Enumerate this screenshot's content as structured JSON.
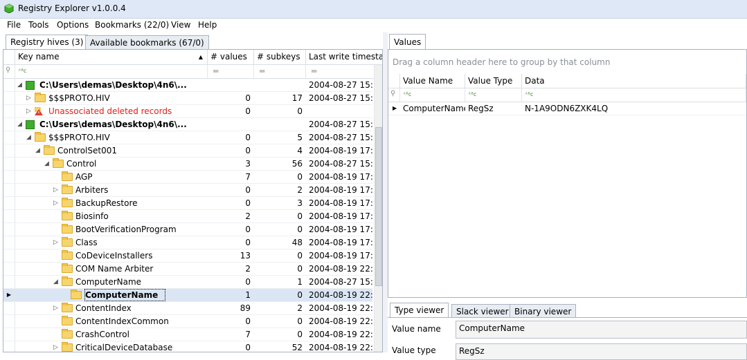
{
  "window": {
    "title": "Registry Explorer v1.0.0.4"
  },
  "menu": [
    "File",
    "Tools",
    "Options",
    "Bookmarks (22/0)",
    "View",
    "Help"
  ],
  "left_tabs": [
    {
      "label": "Registry hives (3)",
      "active": true
    },
    {
      "label": "Available bookmarks (67/0)",
      "active": false
    }
  ],
  "tree_columns": [
    "Key name",
    "# values",
    "# subkeys",
    "Last write timestamp"
  ],
  "filter_symbols": {
    "abc": "ᴬᴮc",
    "eq": "═",
    "pin": "⚲"
  },
  "tree_rows": [
    {
      "name": "C:\\Users\\demas\\Desktop\\4n6\\...",
      "type": "hive",
      "expanded": true,
      "values": "",
      "subkeys": "",
      "ts": "2004-08-27 15:4",
      "bold": true
    },
    {
      "name": "$$$PROTO.HIV",
      "type": "folder",
      "expandable": true,
      "values": "0",
      "subkeys": "17",
      "ts": "2004-08-27 15:1"
    },
    {
      "name": "Unassociated deleted records",
      "type": "warn",
      "expandable": true,
      "values": "0",
      "subkeys": "0",
      "ts": "",
      "red": true
    },
    {
      "name": "C:\\Users\\demas\\Desktop\\4n6\\...",
      "type": "hive",
      "expanded": true,
      "values": "",
      "subkeys": "",
      "ts": "2004-08-27 15:4",
      "bold": true
    },
    {
      "name": "$$$PROTO.HIV",
      "type": "folder",
      "expanded": true,
      "values": "0",
      "subkeys": "5",
      "ts": "2004-08-27 15:0"
    },
    {
      "name": "ControlSet001",
      "type": "folder",
      "expanded": true,
      "values": "0",
      "subkeys": "4",
      "ts": "2004-08-19 17:0"
    },
    {
      "name": "Control",
      "type": "folder",
      "expanded": true,
      "values": "3",
      "subkeys": "56",
      "ts": "2004-08-27 15:0"
    },
    {
      "name": "AGP",
      "type": "folder",
      "values": "7",
      "subkeys": "0",
      "ts": "2004-08-19 17:0"
    },
    {
      "name": "Arbiters",
      "type": "folder",
      "expandable": true,
      "values": "0",
      "subkeys": "2",
      "ts": "2004-08-19 17:0"
    },
    {
      "name": "BackupRestore",
      "type": "folder",
      "expandable": true,
      "values": "0",
      "subkeys": "3",
      "ts": "2004-08-19 17:0"
    },
    {
      "name": "Biosinfo",
      "type": "folder",
      "values": "2",
      "subkeys": "0",
      "ts": "2004-08-19 17:0"
    },
    {
      "name": "BootVerificationProgram",
      "type": "folder",
      "values": "0",
      "subkeys": "0",
      "ts": "2004-08-19 17:0"
    },
    {
      "name": "Class",
      "type": "folder",
      "expandable": true,
      "values": "0",
      "subkeys": "48",
      "ts": "2004-08-19 17:0"
    },
    {
      "name": "CoDeviceInstallers",
      "type": "folder",
      "values": "13",
      "subkeys": "0",
      "ts": "2004-08-19 17:0"
    },
    {
      "name": "COM Name Arbiter",
      "type": "folder",
      "values": "2",
      "subkeys": "0",
      "ts": "2004-08-19 22:5"
    },
    {
      "name": "ComputerName",
      "type": "folder",
      "expanded": true,
      "values": "0",
      "subkeys": "1",
      "ts": "2004-08-27 15:0"
    },
    {
      "name": "ComputerName",
      "type": "folder",
      "selected": true,
      "values": "1",
      "subkeys": "0",
      "ts": "2004-08-19 22:2",
      "bold": true
    },
    {
      "name": "ContentIndex",
      "type": "folder",
      "expandable": true,
      "values": "89",
      "subkeys": "2",
      "ts": "2004-08-19 22:2"
    },
    {
      "name": "ContentIndexCommon",
      "type": "folder",
      "values": "0",
      "subkeys": "0",
      "ts": "2004-08-19 22:2"
    },
    {
      "name": "CrashControl",
      "type": "folder",
      "values": "7",
      "subkeys": "0",
      "ts": "2004-08-19 22:3"
    },
    {
      "name": "CriticalDeviceDatabase",
      "type": "folder",
      "expandable": true,
      "values": "0",
      "subkeys": "52",
      "ts": "2004-08-19 22:2"
    }
  ],
  "values_tab": "Values",
  "group_hint": "Drag a column header here to group by that column",
  "value_columns": [
    "Value Name",
    "Value Type",
    "Data"
  ],
  "value_rows": [
    {
      "name": "ComputerName",
      "type": "RegSz",
      "data": "N-1A9ODN6ZXK4LQ"
    }
  ],
  "viewer_tabs": [
    {
      "label": "Type viewer",
      "active": true
    },
    {
      "label": "Slack viewer",
      "active": false
    },
    {
      "label": "Binary viewer",
      "active": false
    }
  ],
  "viewer": {
    "value_name_label": "Value name",
    "value_name": "ComputerName",
    "value_type_label": "Value type",
    "value_type": "RegSz"
  }
}
